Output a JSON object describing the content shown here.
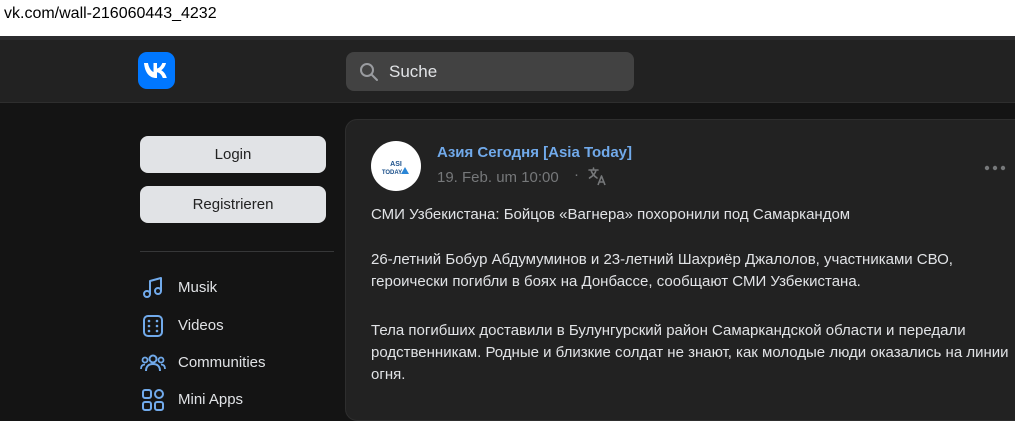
{
  "url": "vk.com/wall-216060443_4232",
  "header": {
    "logo_text": "VK",
    "search_placeholder": "Suche"
  },
  "sidebar": {
    "login_label": "Login",
    "register_label": "Registrieren",
    "items": [
      {
        "label": "Musik",
        "icon": "music-icon"
      },
      {
        "label": "Videos",
        "icon": "video-icon"
      },
      {
        "label": "Communities",
        "icon": "communities-icon"
      },
      {
        "label": "Mini Apps",
        "icon": "apps-icon"
      }
    ]
  },
  "post": {
    "author": "Азия Сегодня [Asia Today]",
    "avatar_text": "ASI TODAY",
    "date": "19. Feb. um 10:00",
    "separator": "·",
    "paragraphs": [
      "СМИ Узбекистана: Бойцов «Вагнера» похоронили под Самаркандом",
      "26-летний Бобур Абдумуминов и 23-летний Шахриёр Джалолов, участниками СВО, героически погибли в боях на Донбассе, сообщают СМИ Узбекистана.",
      "Тела погибших доставили в Булунгурский район Самаркандской области и передали родственникам. Родные и близкие солдат не знают, как молодые люди оказались на линии огня."
    ]
  },
  "colors": {
    "accent": "#0077ff",
    "link": "#71aaeb",
    "background": "#141414",
    "panel": "#222222",
    "icon": "#71aaeb"
  }
}
